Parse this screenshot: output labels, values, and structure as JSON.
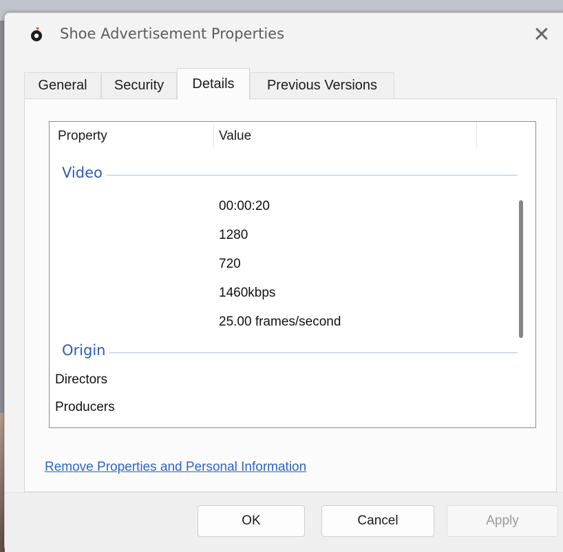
{
  "window": {
    "title": "Shoe Advertisement Properties",
    "close_glyph": "✕"
  },
  "tabs": [
    {
      "label": "General",
      "active": false
    },
    {
      "label": "Security",
      "active": false
    },
    {
      "label": "Details",
      "active": true
    },
    {
      "label": "Previous Versions",
      "active": false
    }
  ],
  "details": {
    "columns": {
      "property": "Property",
      "value": "Value"
    },
    "groups": [
      {
        "name": "Video",
        "rows": [
          {
            "property": "",
            "value": "00:00:20"
          },
          {
            "property": "",
            "value": "1280"
          },
          {
            "property": "",
            "value": "720"
          },
          {
            "property": "",
            "value": "1460kbps"
          },
          {
            "property": "",
            "value": "25.00 frames/second"
          }
        ]
      },
      {
        "name": "Origin",
        "rows": [
          {
            "property": "Directors",
            "value": ""
          },
          {
            "property": "Producers",
            "value": ""
          }
        ]
      }
    ]
  },
  "remove_link": "Remove Properties and Personal Information",
  "buttons": {
    "ok": "OK",
    "cancel": "Cancel",
    "apply": "Apply"
  },
  "colors": {
    "group_label": "#2e5bb8",
    "link": "#2d64c8",
    "app_icon_accent": "#e0582a"
  },
  "icons": {
    "app": "media-file-icon",
    "close": "close-icon"
  }
}
